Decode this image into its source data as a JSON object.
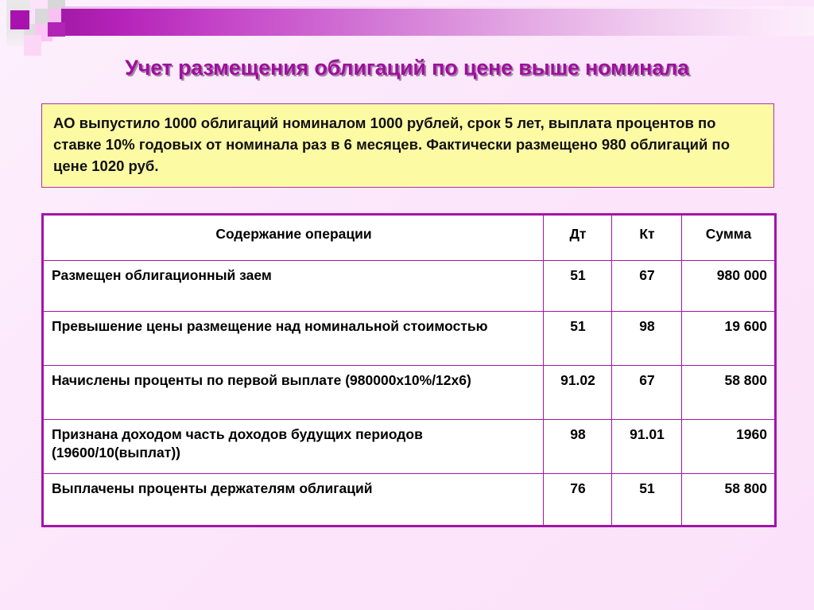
{
  "slide": {
    "title": "Учет размещения облигаций по цене выше номинала",
    "callout": {
      "line1": "АО выпустило 1000 облигаций номиналом 1000 рублей, срок 5 лет, выплата процентов по ставке 10% годовых от номинала раз в 6 месяцев. Фактически размещено 980 облигаций по цене 1020 руб."
    },
    "colors": {
      "accent": "#a414a8",
      "title": "#9e0f9e",
      "callout_bg": "#fdfaa4",
      "callout_border": "#b02fb0",
      "page_bg": "#fce6fb",
      "table_bg": "#ffffff"
    }
  },
  "table": {
    "headers": {
      "description": "Содержание операции",
      "debit": "Дт",
      "credit": "Кт",
      "amount": "Сумма"
    },
    "rows": [
      {
        "description": "Размещен облигационный заем",
        "debit": "51",
        "credit": "67",
        "amount": "980 000"
      },
      {
        "description": "Превышение цены размещение над номинальной стоимостью",
        "debit": "51",
        "credit": "98",
        "amount": "19 600"
      },
      {
        "description": "Начислены проценты по первой выплате (980000х10%/12х6)",
        "debit": "91.02",
        "credit": "67",
        "amount": "58 800"
      },
      {
        "description": "Признана доходом часть доходов будущих периодов (19600/10(выплат))",
        "debit": "98",
        "credit": "91.01",
        "amount": "1960"
      },
      {
        "description": "Выплачены проценты держателям облигаций",
        "debit": "76",
        "credit": "51",
        "amount": "58 800"
      }
    ]
  }
}
